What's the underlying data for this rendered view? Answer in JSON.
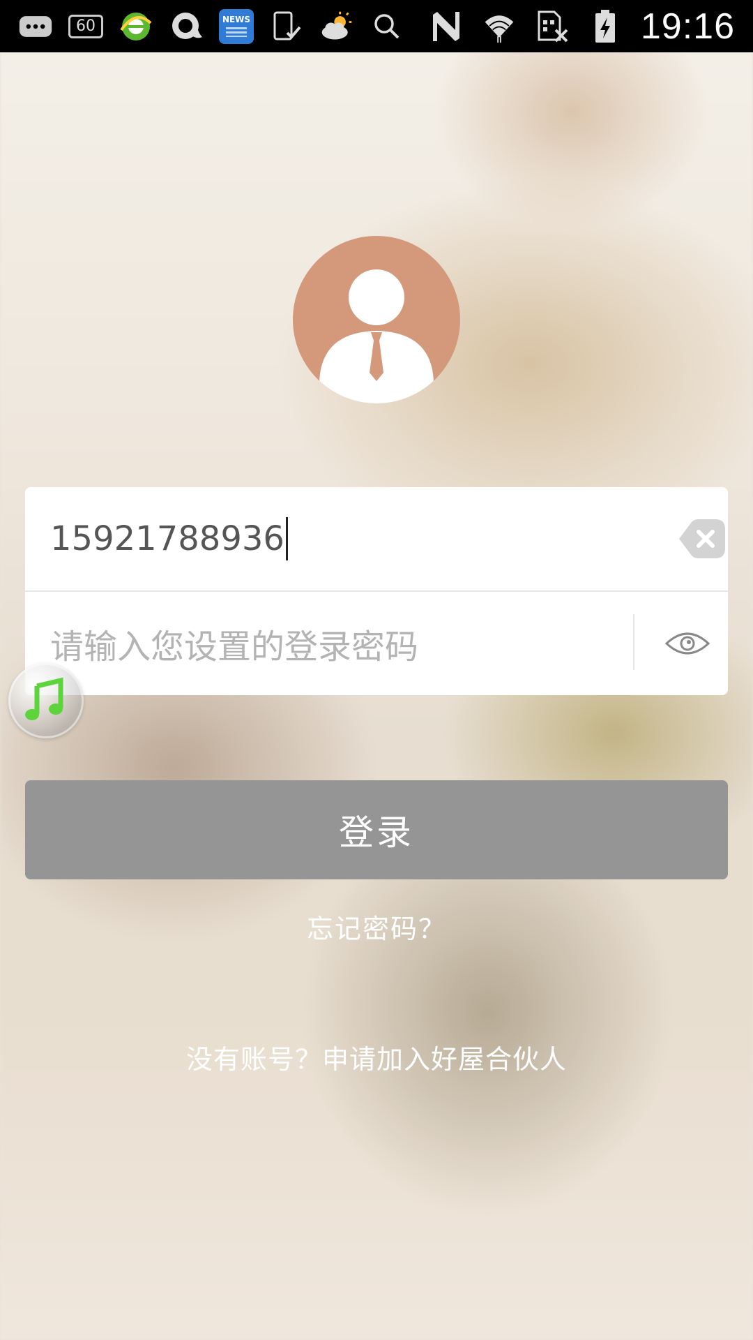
{
  "status_bar": {
    "time": "19:16",
    "indicator_60": "60",
    "news_label": "NEWS",
    "icons_left": [
      "more-icon",
      "sixty-badge-icon",
      "browser-e-icon",
      "chat-bubble-icon",
      "news-icon",
      "phone-check-icon",
      "weather-sun-cloud-icon",
      "search-icon"
    ],
    "icons_right": [
      "nfc-icon",
      "wifi-icon",
      "sim-off-icon",
      "battery-charging-icon"
    ]
  },
  "avatar": {
    "icon": "user-avatar-icon",
    "bg_color": "#d4987b"
  },
  "form": {
    "phone_value": "15921788936",
    "password_placeholder": "请输入您设置的登录密码",
    "clear_icon": "clear-input-icon",
    "toggle_icon": "eye-icon"
  },
  "floating": {
    "icon": "music-note-icon"
  },
  "actions": {
    "login_label": "登录",
    "forgot_label": "忘记密码？",
    "apply_label": "没有账号？申请加入好屋合伙人"
  },
  "colors": {
    "login_button": "#959595",
    "avatar": "#d4987b",
    "status_bar": "#000000"
  }
}
